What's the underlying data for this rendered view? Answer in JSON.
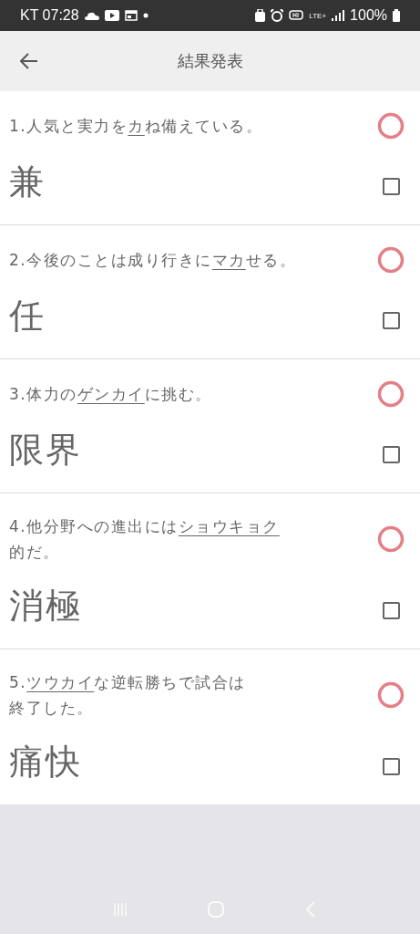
{
  "status_bar": {
    "carrier_time": "KT 07:28",
    "network": "LTE+",
    "battery": "100%"
  },
  "app_bar": {
    "title": "結果発表"
  },
  "questions": [
    {
      "lines": [
        [
          {
            "text": "1.人気と実力を",
            "underlined": false
          },
          {
            "text": "カ",
            "underlined": true
          },
          {
            "text": "ね備えている。",
            "underlined": false
          }
        ]
      ],
      "answer": "兼",
      "correct": true,
      "checked": false
    },
    {
      "lines": [
        [
          {
            "text": "2.今後のことは成り行きに",
            "underlined": false
          },
          {
            "text": "マカ",
            "underlined": true
          },
          {
            "text": "せる。",
            "underlined": false
          }
        ]
      ],
      "answer": "任",
      "correct": true,
      "checked": false
    },
    {
      "lines": [
        [
          {
            "text": "3.体力の",
            "underlined": false
          },
          {
            "text": "ゲンカイ",
            "underlined": true
          },
          {
            "text": "に挑む。",
            "underlined": false
          }
        ]
      ],
      "answer": "限界",
      "correct": true,
      "checked": false
    },
    {
      "lines": [
        [
          {
            "text": "4.他分野への進出には",
            "underlined": false
          },
          {
            "text": "ショウキョク",
            "underlined": true
          }
        ],
        [
          {
            "text": "的だ。",
            "underlined": false
          }
        ]
      ],
      "answer": "消極",
      "correct": true,
      "checked": false
    },
    {
      "lines": [
        [
          {
            "text": "5.",
            "underlined": false
          },
          {
            "text": "ツウカイ",
            "underlined": true
          },
          {
            "text": "な逆転勝ちで試合は",
            "underlined": false
          }
        ],
        [
          {
            "text": "終了した。",
            "underlined": false
          }
        ]
      ],
      "answer": "痛快",
      "correct": true,
      "checked": false
    }
  ]
}
